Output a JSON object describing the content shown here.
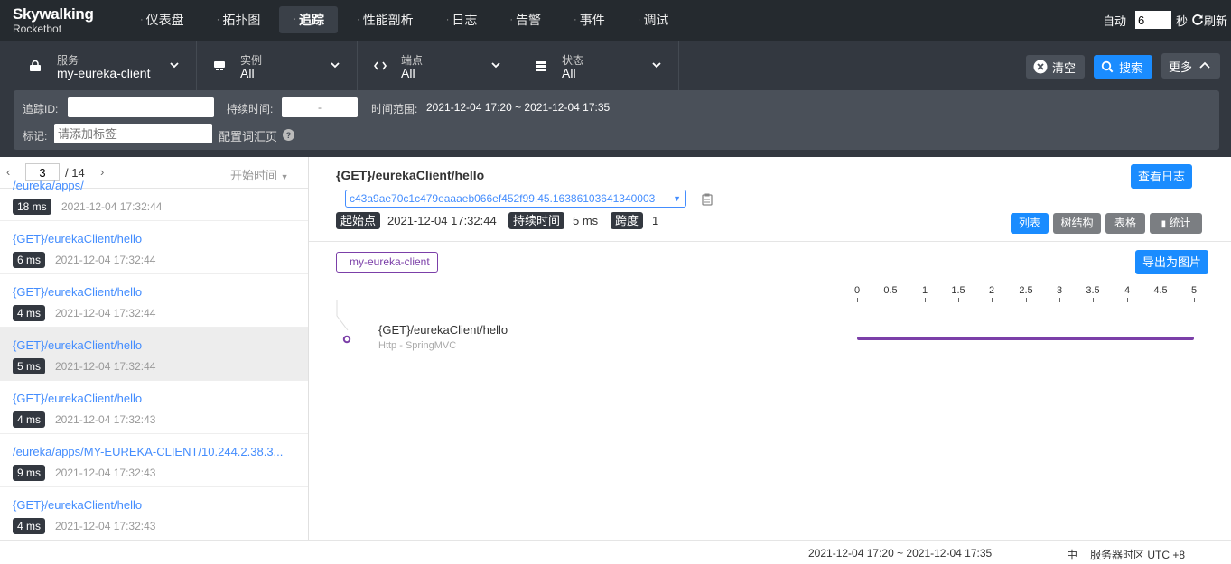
{
  "app": {
    "logo_line1": "Skywalking",
    "logo_line2": "Rocketbot"
  },
  "nav": [
    {
      "label": "仪表盘",
      "active": false
    },
    {
      "label": "拓扑图",
      "active": false
    },
    {
      "label": "追踪",
      "active": true
    },
    {
      "label": "性能剖析",
      "active": false
    },
    {
      "label": "日志",
      "active": false
    },
    {
      "label": "告警",
      "active": false
    },
    {
      "label": "事件",
      "active": false
    },
    {
      "label": "调试",
      "active": false
    }
  ],
  "auto_refresh": {
    "label": "自动",
    "interval": "6",
    "unit": "秒",
    "refresh_label": "刷新"
  },
  "filters": {
    "service": {
      "label": "服务",
      "value": "my-eureka-client"
    },
    "instance": {
      "label": "实例",
      "value": "All"
    },
    "endpoint": {
      "label": "端点",
      "value": "All"
    },
    "status": {
      "label": "状态",
      "value": "All"
    }
  },
  "actions": {
    "clear": "清空",
    "search": "搜索",
    "more": "更多"
  },
  "query": {
    "trace_id_label": "追踪ID:",
    "trace_id_value": "",
    "duration_label": "持续时间:",
    "duration_value": "-",
    "time_range_label": "时间范围:",
    "time_range_value": "2021-12-04 17:20 ~ 2021-12-04 17:35",
    "tags_label": "标记:",
    "tags_placeholder": "请添加标签",
    "config_label": "配置词汇页"
  },
  "pager": {
    "page": "3",
    "total": "/ 14",
    "sort_label": "开始时间"
  },
  "traces": [
    {
      "name": "/eureka/apps/",
      "duration": "18 ms",
      "time": "2021-12-04 17:32:44"
    },
    {
      "name": "{GET}/eurekaClient/hello",
      "duration": "6 ms",
      "time": "2021-12-04 17:32:44"
    },
    {
      "name": "{GET}/eurekaClient/hello",
      "duration": "4 ms",
      "time": "2021-12-04 17:32:44"
    },
    {
      "name": "{GET}/eurekaClient/hello",
      "duration": "5 ms",
      "time": "2021-12-04 17:32:44",
      "selected": true
    },
    {
      "name": "{GET}/eurekaClient/hello",
      "duration": "4 ms",
      "time": "2021-12-04 17:32:43"
    },
    {
      "name": "/eureka/apps/MY-EUREKA-CLIENT/10.244.2.38.3...",
      "duration": "9 ms",
      "time": "2021-12-04 17:32:43"
    },
    {
      "name": "{GET}/eurekaClient/hello",
      "duration": "4 ms",
      "time": "2021-12-04 17:32:43"
    }
  ],
  "detail": {
    "title": "{GET}/eurekaClient/hello",
    "view_logs": "查看日志",
    "trace_id": "c43a9ae70c1c479eaaaeb066ef452f99.45.16386103641340003",
    "start_label": "起始点",
    "start_value": "2021-12-04 17:32:44",
    "duration_label": "持续时间",
    "duration_value": "5 ms",
    "span_label": "跨度",
    "span_value": "1",
    "views": [
      "列表",
      "树结构",
      "表格",
      "统计"
    ],
    "active_view": "列表",
    "service_tag": "my-eureka-client",
    "export_label": "导出为图片",
    "axis": [
      "0",
      "0.5",
      "1",
      "1.5",
      "2",
      "2.5",
      "3",
      "3.5",
      "4",
      "4.5",
      "5"
    ],
    "span": {
      "name": "{GET}/eurekaClient/hello",
      "component": "Http - SpringMVC",
      "start_ms": 0,
      "duration_ms": 5
    }
  },
  "footer": {
    "time_range": "2021-12-04 17:20 ~ 2021-12-04 17:35",
    "lang": "中",
    "timezone": "服务器时区 UTC +8"
  },
  "colors": {
    "accent": "#1a8cff",
    "topbar": "#252a2f",
    "span": "#7b3fa8"
  }
}
